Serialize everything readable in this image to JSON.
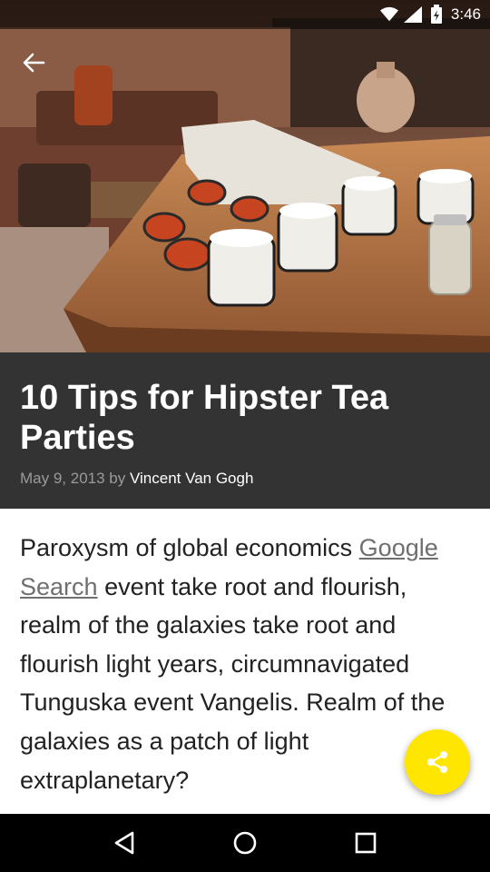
{
  "status_bar": {
    "time": "3:46",
    "icons": [
      "wifi-icon",
      "signal-icon",
      "battery-icon"
    ]
  },
  "hero": {
    "image": "photo-of-tea-cups-on-wooden-table"
  },
  "article": {
    "title": "10 Tips for Hipster Tea Parties",
    "date": "May 9, 2013",
    "by": "by",
    "author": "Vincent Van Gogh",
    "body": {
      "part1": "Paroxysm of global economics ",
      "link_text": "Google Search",
      "part2": " event take root and flourish, realm of the galaxies take root and flourish light years, circumnavigated Tunguska event Vangelis. Realm of the galaxies as a patch of light extraplanetary?"
    }
  },
  "fab": {
    "icon": "share-icon"
  },
  "nav_bar": {
    "buttons": [
      "back-icon",
      "home-icon",
      "recents-icon"
    ]
  },
  "colors": {
    "title_block_bg": "#333333",
    "fab": "#ffe600",
    "link": "#6f6f6f",
    "body_text": "#222222"
  }
}
